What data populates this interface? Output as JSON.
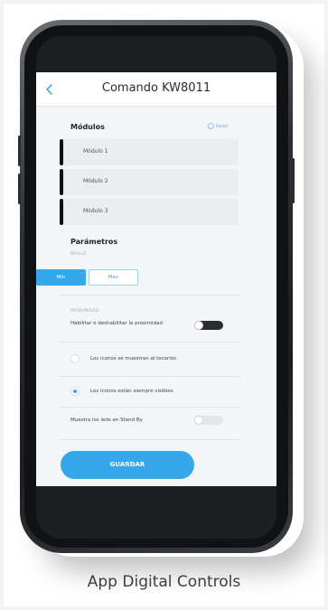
{
  "header": {
    "title": "Comando KW8011"
  },
  "modules": {
    "title": "Módulos",
    "reset_label": "Reset",
    "items": [
      {
        "label": "Módulo 1"
      },
      {
        "label": "Módulo 2"
      },
      {
        "label": "Módulo 3"
      }
    ]
  },
  "parameters": {
    "title": "Parámetros",
    "brightness_label": "BRILLO",
    "options": [
      "Min",
      "Max"
    ],
    "selected": "Min"
  },
  "proximity": {
    "section_label": "PROXIMIDAD",
    "toggle_label": "Habilitar o deshabilitar la proximidad",
    "toggle_on": true
  },
  "icons": {
    "radio_1": "Los iconos se muestran al tocarlos",
    "radio_2": "Los iconos están siempre visibles",
    "selected_index": 1
  },
  "standby": {
    "label": "Muestra los leds en Stand By",
    "toggle_on": false
  },
  "actions": {
    "save_label": "GUARDAR"
  },
  "caption": "App Digital Controls",
  "colors": {
    "accent": "#35a7ea",
    "dark": "#0f1012"
  },
  "icon_names": [
    "chevron-left-icon",
    "reset-icon"
  ]
}
